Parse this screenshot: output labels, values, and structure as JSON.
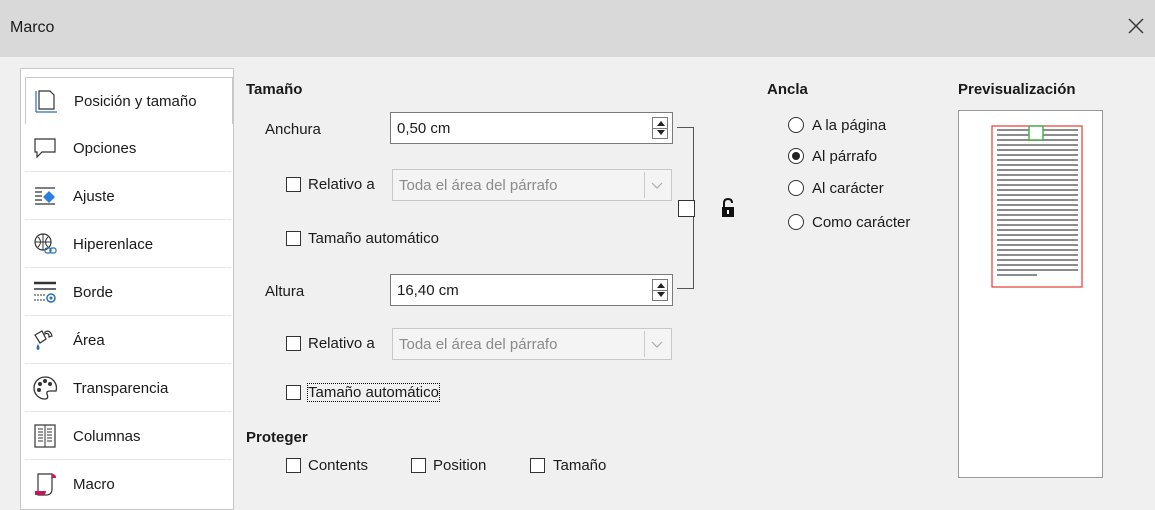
{
  "window": {
    "title": "Marco",
    "close_icon": "close-icon"
  },
  "sidebar": {
    "items": [
      {
        "label": "Posición y tamaño",
        "icon": "position-size-icon",
        "selected": true
      },
      {
        "label": "Opciones",
        "icon": "speech-bubble-icon"
      },
      {
        "label": "Ajuste",
        "icon": "wrap-icon"
      },
      {
        "label": "Hiperenlace",
        "icon": "hyperlink-globe-icon"
      },
      {
        "label": "Borde",
        "icon": "border-icon"
      },
      {
        "label": "Área",
        "icon": "area-fill-icon"
      },
      {
        "label": "Transparencia",
        "icon": "transparency-palette-icon"
      },
      {
        "label": "Columnas",
        "icon": "columns-icon"
      },
      {
        "label": "Macro",
        "icon": "macro-icon"
      }
    ]
  },
  "size": {
    "heading": "Tamaño",
    "width_label": "Anchura",
    "width_value": "0,50 cm",
    "width_relative_label": "Relativo a",
    "width_relative_value": "Toda el área del párrafo",
    "width_auto_label": "Tamaño automático",
    "height_label": "Altura",
    "height_value": "16,40 cm",
    "height_relative_label": "Relativo a",
    "height_relative_value": "Toda el área del párrafo",
    "height_auto_label": "Tamaño automático",
    "lock_icon": "unlock-icon"
  },
  "anchor": {
    "heading": "Ancla",
    "options": [
      {
        "label": "A la página",
        "selected": false
      },
      {
        "label": "Al párrafo",
        "selected": true
      },
      {
        "label": "Al carácter",
        "selected": false
      },
      {
        "label": "Como carácter",
        "selected": false
      }
    ]
  },
  "preview": {
    "heading": "Previsualización"
  },
  "protect": {
    "heading": "Proteger",
    "contents_label": "Contents",
    "position_label": "Position",
    "size_label": "Tamaño"
  }
}
